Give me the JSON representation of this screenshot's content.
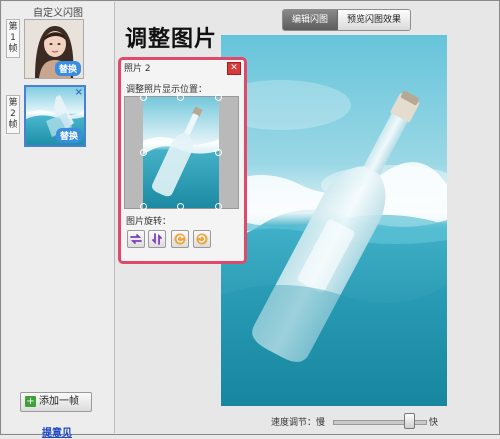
{
  "left_panel": {
    "title": "自定义闪图",
    "frames": [
      {
        "label": "第1帧",
        "replace_label": "替换",
        "image": "woman-portrait-thumbnail"
      },
      {
        "label": "第2帧",
        "replace_label": "替换",
        "image": "bottle-in-water-thumbnail",
        "close": "×"
      }
    ],
    "add_frame_label": "添加一帧",
    "add_icon": "plus-icon",
    "feedback_link": "提意见"
  },
  "tabs": [
    {
      "label": "编辑闪图",
      "active": true
    },
    {
      "label": "预览闪图效果",
      "active": false
    }
  ],
  "main_title": "调整图片",
  "dialog": {
    "title": "照片 2",
    "close_label": "✕",
    "crop_label": "调整照片显示位置：",
    "rotate_label": "图片旋转：",
    "rotate_buttons": [
      "flip-horizontal-icon",
      "flip-vertical-icon",
      "rotate-left-icon",
      "rotate-right-icon"
    ]
  },
  "speed": {
    "label": "速度调节：慢",
    "fast_label": "快",
    "value_fraction": 0.85
  },
  "colors": {
    "accent": "#e04a6a",
    "link": "#1a46c8",
    "replace_button": "#3a8ee0",
    "water": "#3aa9c2"
  }
}
